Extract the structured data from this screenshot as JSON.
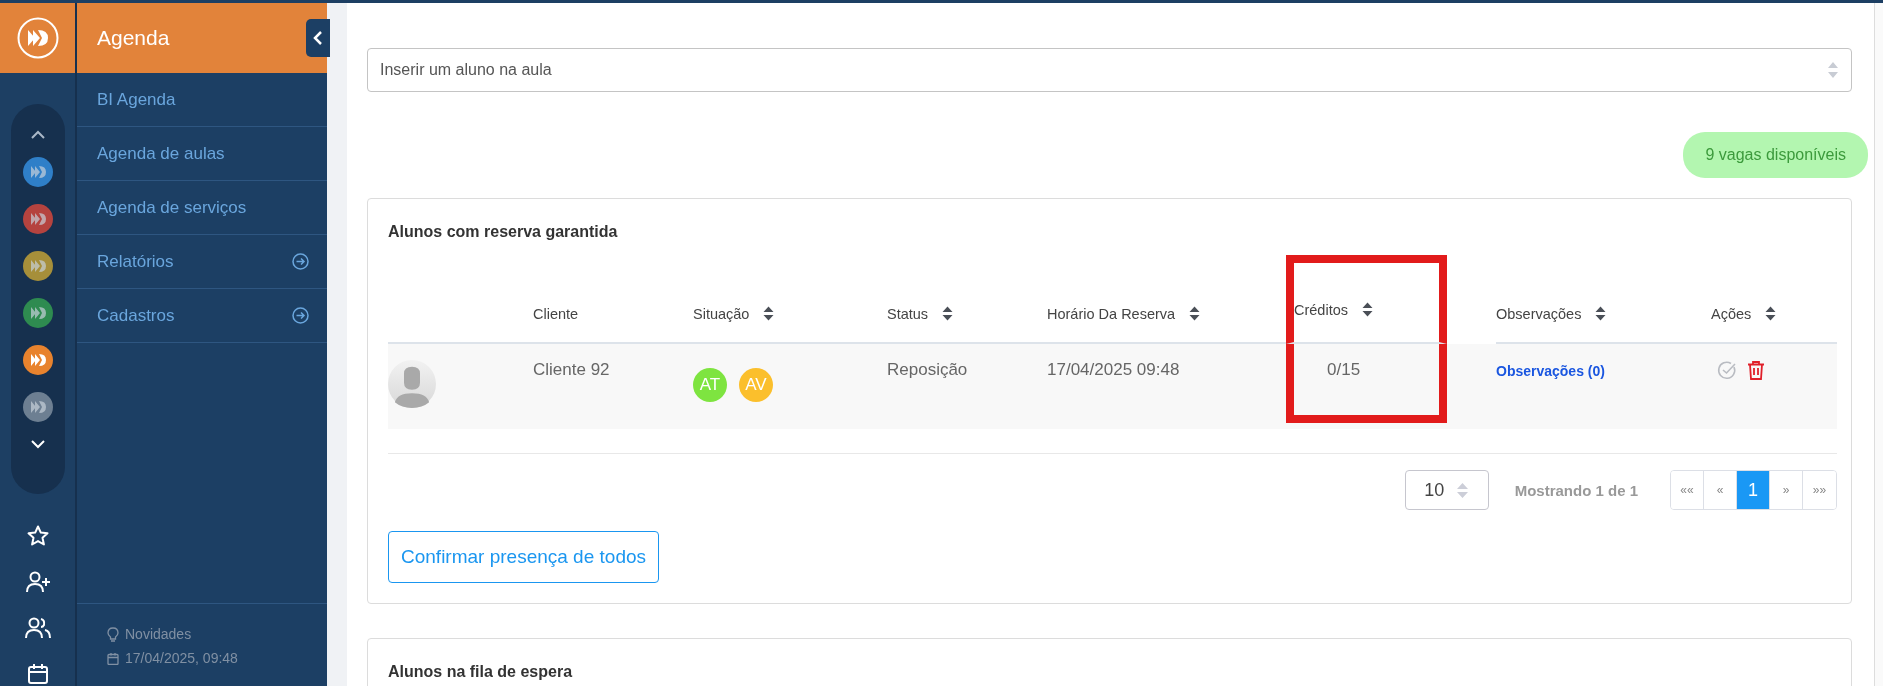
{
  "rail": {
    "units": [
      {
        "color": "#2f7fc8",
        "selected": false
      },
      {
        "color": "#b5433f",
        "selected": false
      },
      {
        "color": "#a68f3a",
        "selected": false
      },
      {
        "color": "#2e8b50",
        "selected": false
      },
      {
        "color": "#e8832e",
        "selected": true
      },
      {
        "color": "#6d7f92",
        "selected": false
      }
    ]
  },
  "menu": {
    "title": "Agenda",
    "items": [
      {
        "label": "BI Agenda",
        "has_submenu": false
      },
      {
        "label": "Agenda de aulas",
        "has_submenu": false
      },
      {
        "label": "Agenda de serviços",
        "has_submenu": false
      },
      {
        "label": "Relatórios",
        "has_submenu": true
      },
      {
        "label": "Cadastros",
        "has_submenu": true
      }
    ],
    "footer": {
      "news": "Novidades",
      "datetime": "17/04/2025, 09:48"
    }
  },
  "student_select": {
    "placeholder": "Inserir um aluno na aula"
  },
  "vacancy_badge": "9 vagas disponíveis",
  "reserved_card": {
    "title": "Alunos com reserva garantida",
    "columns": [
      {
        "sortable": false,
        "highlighted": false
      },
      {
        "label": "Cliente",
        "sortable": false,
        "highlighted": false
      },
      {
        "label": "Situação",
        "sortable": true,
        "highlighted": false
      },
      {
        "label": "Status",
        "sortable": true,
        "highlighted": false
      },
      {
        "label": "Horário Da Reserva",
        "sortable": true,
        "highlighted": false
      },
      {
        "label": "Créditos",
        "sortable": true,
        "highlighted": true
      },
      {
        "label": "Observações",
        "sortable": true,
        "highlighted": false
      },
      {
        "label": "Ações",
        "sortable": true,
        "highlighted": false
      }
    ],
    "rows": [
      {
        "client": "Cliente 92",
        "situation": [
          {
            "label": "AT",
            "color": "#7ee440"
          },
          {
            "label": "AV",
            "color": "#fbbf2c"
          }
        ],
        "status": "Reposição",
        "time": "17/04/2025 09:48",
        "credits": "0/15",
        "notes_link": "Observações (0)"
      }
    ],
    "page_size": "10",
    "showing": "Mostrando 1 de 1",
    "pages": [
      {
        "label": "««",
        "selected": false
      },
      {
        "label": "«",
        "selected": false
      },
      {
        "label": "1",
        "selected": true
      },
      {
        "label": "»",
        "selected": false
      },
      {
        "label": "»»",
        "selected": false
      }
    ],
    "confirm_button": "Confirmar presença de todos"
  },
  "waiting_card": {
    "title": "Alunos na fila de espera"
  }
}
